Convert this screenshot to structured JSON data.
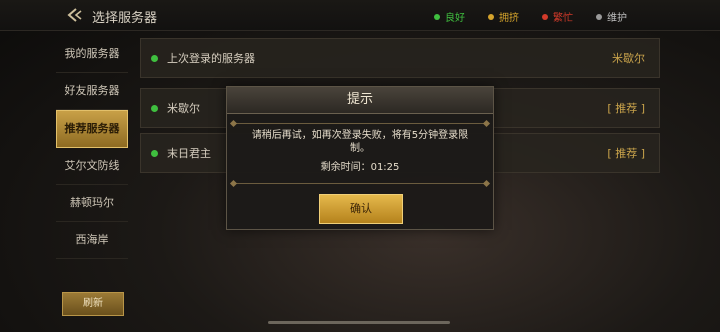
{
  "header": {
    "title": "选择服务器"
  },
  "legend": [
    {
      "label": "良好",
      "color": "#3fbf3f"
    },
    {
      "label": "拥挤",
      "color": "#d4a32c"
    },
    {
      "label": "繁忙",
      "color": "#d23a2a"
    },
    {
      "label": "维护",
      "color": "#9a9a9a"
    }
  ],
  "sidebar": {
    "items": [
      {
        "label": "我的服务器",
        "active": false
      },
      {
        "label": "好友服务器",
        "active": false
      },
      {
        "label": "推荐服务器",
        "active": true
      },
      {
        "label": "艾尔文防线",
        "active": false
      },
      {
        "label": "赫顿玛尔",
        "active": false
      },
      {
        "label": "西海岸",
        "active": false
      }
    ],
    "refresh_label": "刷新"
  },
  "last_login": {
    "label": "上次登录的服务器",
    "server": "米歇尔"
  },
  "servers": [
    {
      "name": "米歇尔",
      "tag": "[ 推荐 ]"
    },
    {
      "name": "末日君主",
      "tag": "[ 推荐 ]"
    }
  ],
  "dialog": {
    "title": "提示",
    "message": "请稍后再试，如再次登录失败，将有5分钟登录限制。",
    "timer_label": "剩余时间：",
    "timer_value": "01:25",
    "confirm_label": "确认"
  }
}
